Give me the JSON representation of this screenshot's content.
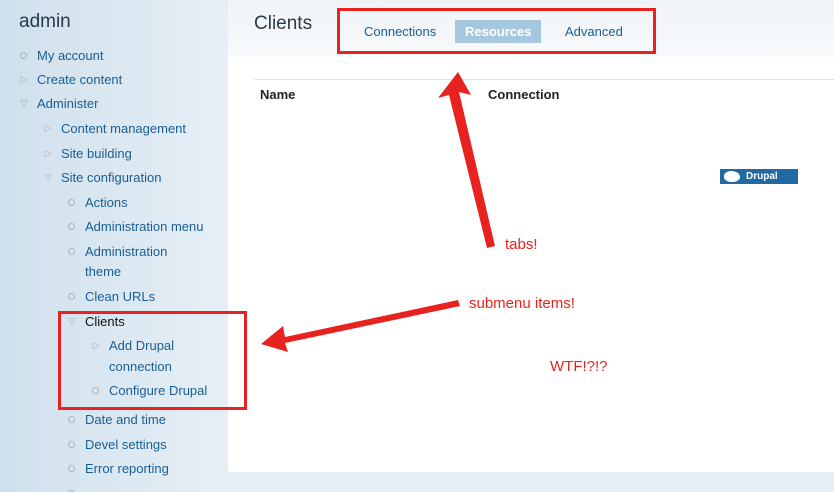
{
  "sidebar": {
    "title": "admin",
    "items": [
      {
        "label": "My account",
        "bullet": "leaf"
      },
      {
        "label": "Create content",
        "bullet": "collapsed"
      },
      {
        "label": "Administer",
        "bullet": "expanded"
      },
      {
        "label": "Content management",
        "bullet": "collapsed"
      },
      {
        "label": "Site building",
        "bullet": "collapsed"
      },
      {
        "label": "Site configuration",
        "bullet": "expanded"
      },
      {
        "label": "Actions",
        "bullet": "leaf"
      },
      {
        "label": "Administration menu",
        "bullet": "leaf"
      },
      {
        "label": "Administration",
        "bullet": "leaf"
      },
      {
        "label": "theme",
        "bullet": "none"
      },
      {
        "label": "Clean URLs",
        "bullet": "leaf"
      },
      {
        "label": "Clients",
        "bullet": "expanded"
      },
      {
        "label": "Add Drupal",
        "bullet": "collapsed"
      },
      {
        "label": "connection",
        "bullet": "none"
      },
      {
        "label": "Configure Drupal",
        "bullet": "leaf"
      },
      {
        "label": "Date and time",
        "bullet": "leaf"
      },
      {
        "label": "Devel settings",
        "bullet": "leaf"
      },
      {
        "label": "Error reporting",
        "bullet": "leaf"
      }
    ]
  },
  "main": {
    "title": "Clients",
    "tabs": [
      {
        "label": "Connections",
        "active": false
      },
      {
        "label": "Resources",
        "active": true
      },
      {
        "label": "Advanced",
        "active": false
      }
    ],
    "table": {
      "columns": [
        "Name",
        "Connection"
      ]
    },
    "badge": {
      "label": "Drupal"
    }
  },
  "annotations": {
    "tabs": "tabs!",
    "submenu": "submenu items!",
    "wtf": "WTF!?!?"
  },
  "colors": {
    "accent_link": "#1a5e93",
    "annotation_red": "#e8231f",
    "active_tab_bg": "#a6c8de",
    "sidebar_bg": "#d8e6f0"
  }
}
